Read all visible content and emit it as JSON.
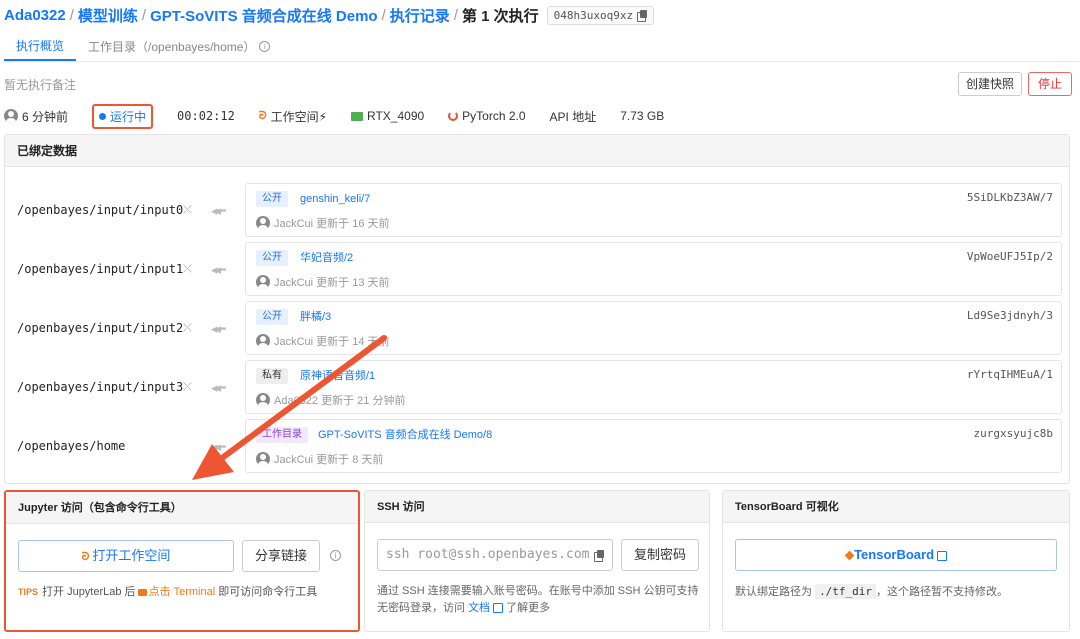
{
  "breadcrumb": {
    "user": "Ada0322",
    "section": "模型训练",
    "project": "GPT-SoVITS 音频合成在线 Demo",
    "records": "执行记录",
    "current": "第 1 次执行",
    "hash": "048h3uxoq9xz",
    "sep": "/"
  },
  "tabs": [
    {
      "label": "执行概览"
    },
    {
      "label": "工作目录（/openbayes/home）"
    }
  ],
  "note": "暂无执行备注",
  "actions": {
    "snapshot": "创建快照",
    "stop": "停止"
  },
  "status": {
    "time_ago": "6 分钟前",
    "state": "运行中",
    "duration": "00:02:12",
    "workspace": "工作空间⚡",
    "gpu": "RTX_4090",
    "framework": "PyTorch 2.0",
    "api": "API 地址",
    "size": "7.73 GB"
  },
  "bound_data": {
    "title": "已绑定数据",
    "rows": [
      {
        "path": "/openbayes/input/input0",
        "tag": "公开",
        "name": "genshin_keli/7",
        "id": "5SiDLKbZ3AW/7",
        "meta": "JackCui 更新于 16 天前"
      },
      {
        "path": "/openbayes/input/input1",
        "tag": "公开",
        "name": "华妃音频/2",
        "id": "VpWoeUFJ5Ip/2",
        "meta": "JackCui 更新于 13 天前"
      },
      {
        "path": "/openbayes/input/input2",
        "tag": "公开",
        "name": "胖橘/3",
        "id": "Ld9Se3jdnyh/3",
        "meta": "JackCui 更新于 14 天前"
      },
      {
        "path": "/openbayes/input/input3",
        "tag": "私有",
        "name": "原神语音音频/1",
        "id": "rYrtqIHMEuA/1",
        "meta": "Ada0322 更新于 21 分钟前"
      },
      {
        "path": "/openbayes/home",
        "tag": "工作目录",
        "name": "GPT-SoVITS 音频合成在线 Demo/8",
        "id": "zurgxsyujc8b",
        "meta": "JackCui 更新于 8 天前"
      }
    ]
  },
  "jupyter": {
    "title": "Jupyter 访问（包含命令行工具）",
    "open": "打开工作空间",
    "share": "分享链接",
    "tips_key": "TIPS",
    "tips_a": "打开 JupyterLab 后",
    "tips_b": "点击 Terminal",
    "tips_c": " 即可访问命令行工具"
  },
  "ssh": {
    "title": "SSH 访问",
    "command": "ssh root@ssh.openbayes.com",
    "copy_pw": "复制密码",
    "desc_a": "通过 SSH 连接需要输入账号密码。在账号中添加 SSH 公钥可支持无密码登录，访问",
    "desc_link": "文档",
    "desc_b": " 了解更多"
  },
  "tensorboard": {
    "title": "TensorBoard 可视化",
    "button": "TensorBoard",
    "desc_a": "默认绑定路径为",
    "desc_code": "./tf_dir",
    "desc_b": "，这个路径暂不支持修改。"
  },
  "colors": {
    "accent": "#1677ff",
    "annotation": "#e53"
  }
}
